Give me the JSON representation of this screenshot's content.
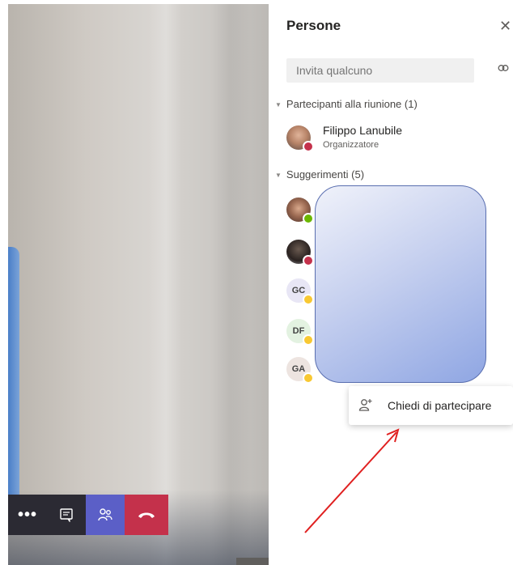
{
  "panel": {
    "title": "Persone",
    "close_icon": "close-icon",
    "invite_placeholder": "Invita qualcuno",
    "copy_link_icon": "link-icon"
  },
  "meeting_section": {
    "label": "Partecipanti alla riunione (1)",
    "participants": [
      {
        "name": "Filippo Lanubile",
        "role": "Organizzatore",
        "status": "busy",
        "status_color": "#c4314b"
      }
    ]
  },
  "suggestions_section": {
    "label": "Suggerimenti (5)",
    "items": [
      {
        "initials": "",
        "status_color": "#6bb700",
        "avatar": "photo"
      },
      {
        "initials": "",
        "status_color": "#c4314b",
        "avatar": "photo"
      },
      {
        "initials": "GC",
        "status_color": "#f8c832",
        "avatar_bg": "#e8e6f5"
      },
      {
        "initials": "DF",
        "status_color": "#f8c832",
        "avatar_bg": "#e3f2e1"
      },
      {
        "initials": "GA",
        "status_color": "#f8c832",
        "avatar_bg": "#ede4e0"
      }
    ]
  },
  "context_menu": {
    "action_label": "Chiedi di partecipare",
    "icon": "add-person-icon"
  },
  "toolbar": {
    "more_icon": "more-icon",
    "chat_icon": "chat-icon",
    "people_icon": "people-icon",
    "hangup_icon": "hangup-icon",
    "hangup_color": "#c4314b",
    "people_color": "#5b5fc7"
  },
  "annotation": {
    "arrow_color": "#e02020"
  }
}
